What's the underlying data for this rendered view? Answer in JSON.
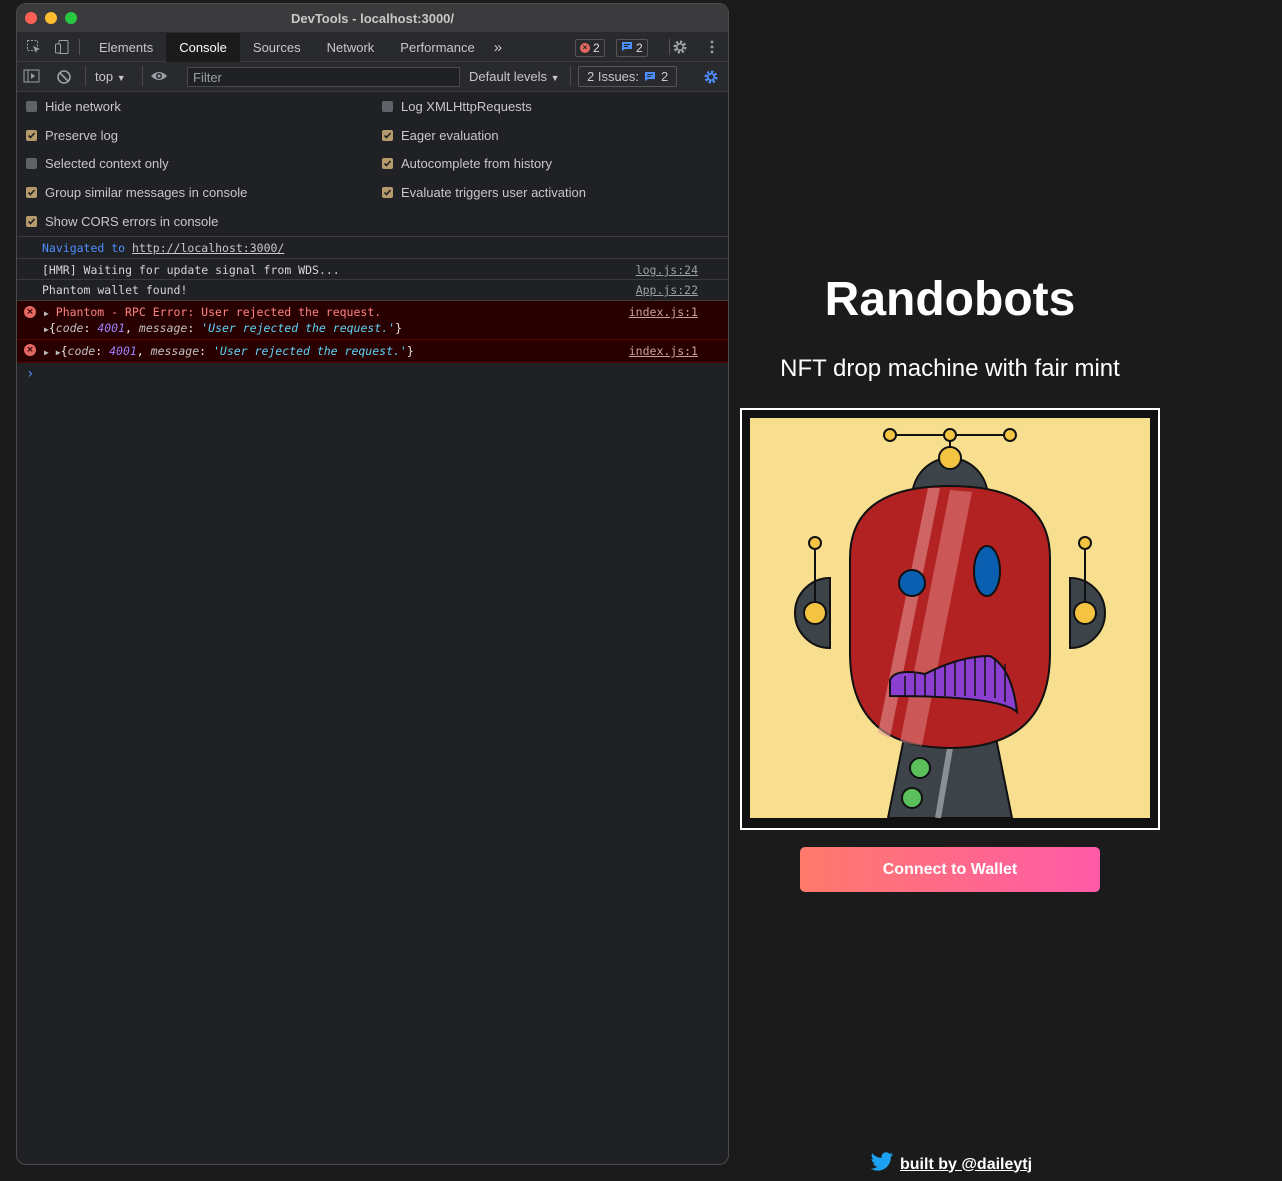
{
  "window": {
    "title": "DevTools - localhost:3000/"
  },
  "tabs": [
    "Elements",
    "Console",
    "Sources",
    "Network",
    "Performance"
  ],
  "tab_more": "»",
  "badges": {
    "errors": "2",
    "messages": "2"
  },
  "toolbar": {
    "context": "top",
    "filter_placeholder": "Filter",
    "levels": "Default levels",
    "issues_label": "2 Issues:",
    "issues_count": "2"
  },
  "settings": [
    {
      "label": "Hide network",
      "checked": false
    },
    {
      "label": "Log XMLHttpRequests",
      "checked": false
    },
    {
      "label": "Preserve log",
      "checked": true
    },
    {
      "label": "Eager evaluation",
      "checked": true
    },
    {
      "label": "Selected context only",
      "checked": false
    },
    {
      "label": "Autocomplete from history",
      "checked": true
    },
    {
      "label": "Group similar messages in console",
      "checked": true
    },
    {
      "label": "Evaluate triggers user activation",
      "checked": true
    },
    {
      "label": "Show CORS errors in console",
      "checked": true
    }
  ],
  "console": {
    "nav_prefix": "Navigated to",
    "nav_url": "http://localhost:3000/",
    "hmr_text": "[HMR] Waiting for update signal from WDS...",
    "hmr_src": "log.js:24",
    "phantom_text": "Phantom wallet found!",
    "phantom_src": "App.js:22",
    "error1_text": "Phantom - RPC Error: User rejected the request.",
    "error1_src": "index.js:1",
    "error2_src": "index.js:1",
    "obj_open": "{",
    "obj_code_key": "code",
    "obj_code_val": "4001",
    "obj_msg_key": "message",
    "obj_msg_val": "'User rejected the request.'",
    "obj_close": "}",
    "prompt": "›"
  },
  "app": {
    "title": "Randobots",
    "subtitle": "NFT drop machine with fair mint",
    "connect_label": "Connect to Wallet",
    "footer_text": "built by @daileytj"
  },
  "colors": {
    "nft_background": "#f7df8f",
    "robot_face": "#b22222",
    "robot_body": "#3d4449",
    "mouth": "#8a3fd1",
    "button_from": "#ff7a6b",
    "button_to": "#ff5aa8"
  }
}
